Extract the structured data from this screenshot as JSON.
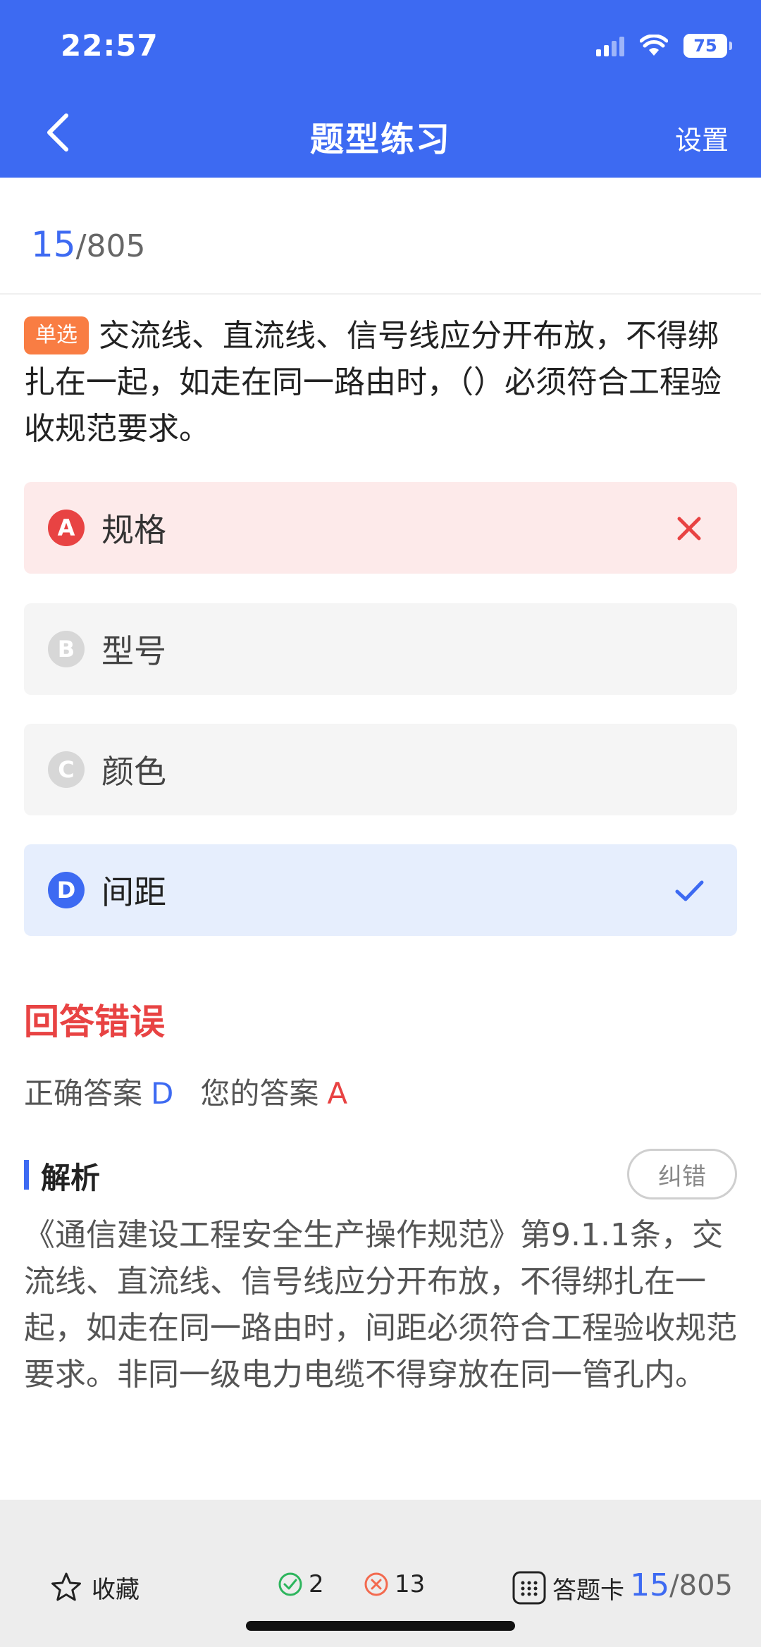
{
  "status_bar": {
    "time": "22:57",
    "battery": "75"
  },
  "nav": {
    "title": "题型练习",
    "settings": "设置"
  },
  "progress": {
    "current": "15",
    "total": "/805"
  },
  "question": {
    "type_badge": "单选",
    "text": "交流线、直流线、信号线应分开布放，不得绑扎在一起，如走在同一路由时，（）必须符合工程验收规范要求。"
  },
  "options": [
    {
      "letter": "A",
      "text": "规格",
      "state": "wrong"
    },
    {
      "letter": "B",
      "text": "型号",
      "state": "normal"
    },
    {
      "letter": "C",
      "text": "颜色",
      "state": "normal"
    },
    {
      "letter": "D",
      "text": "间距",
      "state": "correct"
    }
  ],
  "result": {
    "title": "回答错误",
    "correct_label": "正确答案",
    "correct_value": "D",
    "user_label": "您的答案",
    "user_value": "A"
  },
  "analysis": {
    "title": "解析",
    "report_button": "纠错",
    "text": "《通信建设工程安全生产操作规范》第9.1.1条，交流线、直流线、信号线应分开布放，不得绑扎在一起，如走在同一路由时，间距必须符合工程验收规范要求。非同一级电力电缆不得穿放在同一管孔内。"
  },
  "bottom_bar": {
    "favorite": "收藏",
    "correct_count": "2",
    "wrong_count": "13",
    "answer_card": "答题卡",
    "progress_current": "15",
    "progress_total": "/805"
  },
  "colors": {
    "primary": "#3D6AF2",
    "error": "#E84343",
    "badge": "#F97D43"
  }
}
